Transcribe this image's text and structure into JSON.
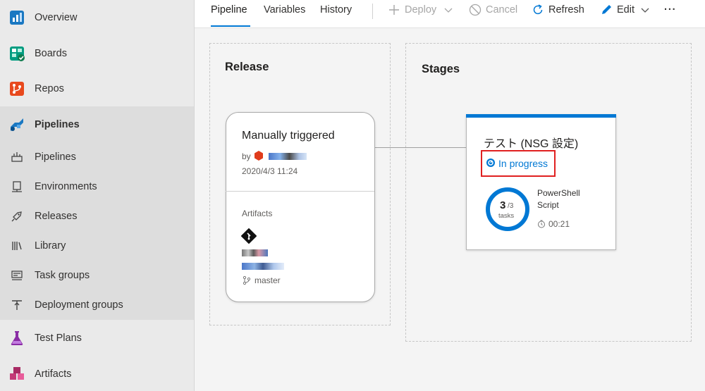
{
  "sidebar": {
    "top_items": [
      {
        "label": "Overview",
        "icon": "overview-icon"
      },
      {
        "label": "Boards",
        "icon": "boards-icon"
      },
      {
        "label": "Repos",
        "icon": "repos-icon"
      },
      {
        "label": "Pipelines",
        "icon": "pipelines-icon"
      }
    ],
    "sub_items": [
      {
        "label": "Pipelines",
        "icon": "pipelines-sub-icon"
      },
      {
        "label": "Environments",
        "icon": "environments-icon"
      },
      {
        "label": "Releases",
        "icon": "releases-icon"
      },
      {
        "label": "Library",
        "icon": "library-icon"
      },
      {
        "label": "Task groups",
        "icon": "task-groups-icon"
      },
      {
        "label": "Deployment groups",
        "icon": "deployment-groups-icon"
      }
    ],
    "bottom_items": [
      {
        "label": "Test Plans",
        "icon": "test-plans-icon"
      },
      {
        "label": "Artifacts",
        "icon": "artifacts-icon"
      }
    ]
  },
  "toolbar": {
    "tabs": [
      "Pipeline",
      "Variables",
      "History"
    ],
    "active_tab": "Pipeline",
    "deploy_label": "Deploy",
    "cancel_label": "Cancel",
    "refresh_label": "Refresh",
    "edit_label": "Edit",
    "more_label": "···"
  },
  "release": {
    "section_title": "Release",
    "card_title": "Manually triggered",
    "by_label": "by",
    "timestamp": "2020/4/3 11:24",
    "artifacts_label": "Artifacts",
    "branch": "master"
  },
  "stages": {
    "section_title": "Stages",
    "stage_name": "テスト (NSG 設定)",
    "status": "In progress",
    "tasks_done": "3",
    "tasks_total": "/3",
    "tasks_label": "tasks",
    "progress_fraction": 1.0,
    "current_task": "PowerShell\nScript",
    "current_task_line1": "PowerShell",
    "current_task_line2": "Script",
    "elapsed": "00:21"
  },
  "colors": {
    "accent": "#0078d4",
    "highlight": "#e02020",
    "disabled": "#a6a6a6",
    "repos_orange": "#e8491d",
    "test_plans_purple": "#8a2da5",
    "artifacts_pink": "#c43977",
    "boards_green": "#009c80"
  }
}
